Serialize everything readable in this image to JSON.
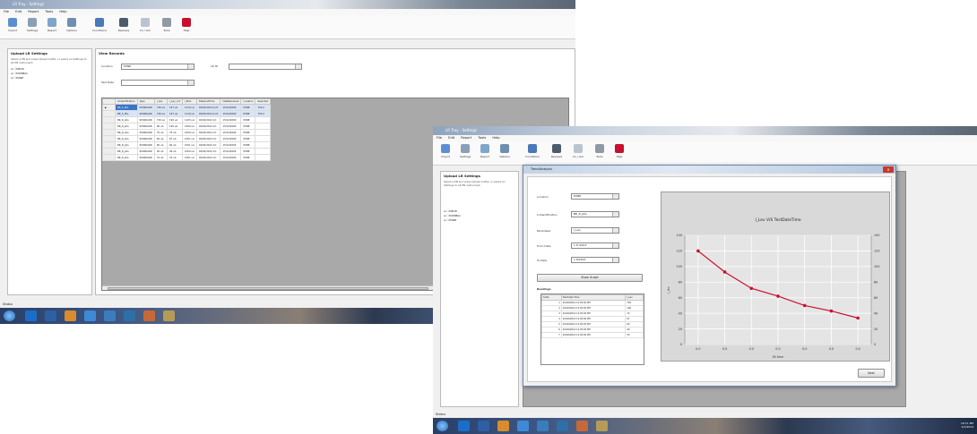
{
  "main_window": {
    "title": "LR Tray - Settings",
    "menu": [
      "File",
      "Edit",
      "Report",
      "Tools",
      "Help"
    ],
    "toolbar": [
      "Import",
      "Settings",
      "Report",
      "Options",
      "Conditions",
      "Reviews",
      "Co / Lim",
      "Tools",
      "Help"
    ],
    "left_panel": {
      "heading": "Upload LR Settings",
      "description": "Select a PN and press Upload button or select an Settings to LR PN instrument.",
      "tree": [
        "DELHI",
        "MUMBAI",
        "PUNE"
      ]
    },
    "view_records": {
      "heading": "View Records",
      "location_label": "Location",
      "location_value": "PUNE",
      "lrid_label": "LR ID",
      "lrid_value": "",
      "date_label": "Test Date",
      "date_value": ""
    },
    "grid": {
      "columns": [
        "LrIdentification",
        "Type",
        "I_Lev",
        "I_Lev_cnt",
        "I_Max",
        "DateAndTime",
        "DateReceived",
        "Location",
        "Reported"
      ],
      "rows": [
        [
          "BR_5_Phs",
          "STANDARD",
          "720 uA",
          "197 uA",
          "1110 uA",
          "02/02/2014 4:21",
          "15/12/2000",
          "PUNE",
          "720 A"
        ],
        [
          "BR_5_Phs",
          "STANDARD",
          "720 uA",
          "197 uA",
          "1110 uA",
          "02/02/2014 4:21",
          "15/12/2000",
          "PUNE",
          "720 A"
        ],
        [
          "BR_R_phs",
          "STANDARD",
          "720 uA",
          "190 uA",
          "1105 uA",
          "02/02/2014 12:",
          "15/12/2000",
          "PUNE",
          ""
        ],
        [
          "BR_R_phs",
          "STANDARD",
          "80 uA",
          "190 uA",
          "1050 uA",
          "02/02/2014 12:",
          "15/12/2000",
          "PUNE",
          ""
        ],
        [
          "BR_R_phs",
          "STANDARD",
          "70 uA",
          "70 uA",
          "1050 uA",
          "02/02/2014 12:",
          "15/12/2000",
          "PUNE",
          ""
        ],
        [
          "BR_R_phs",
          "STANDARD",
          "60 uA",
          "67 uA",
          "1051 uA",
          "02/02/2014 12:",
          "15/12/2000",
          "PUNE",
          ""
        ],
        [
          "BR_R_phs",
          "STANDARD",
          "60 uA",
          "60 uA",
          "1051 uA",
          "02/02/2014 12:",
          "15/12/2000",
          "PUNE",
          ""
        ],
        [
          "BR_R_phs",
          "STANDARD",
          "40 uA",
          "40 uA",
          "1050 uA",
          "02/02/2014 12:",
          "15/12/2000",
          "PUNE",
          ""
        ],
        [
          "BR_R_phs",
          "STANDARD",
          "31 uA",
          "33 uA",
          "1051 uA",
          "02/02/2014 12:",
          "15/12/2000",
          "PUNE",
          ""
        ]
      ]
    },
    "status": "Status"
  },
  "second_window": {
    "title": "LR Tray - Settings",
    "menu": [
      "File",
      "Edit",
      "Report",
      "Tools",
      "Help"
    ],
    "toolbar": [
      "Import",
      "Settings",
      "Report",
      "Options",
      "Conditions",
      "Reviews",
      "Co / Lim",
      "Tools",
      "Help"
    ],
    "left_panel": {
      "heading": "Upload LR Settings",
      "description": "Select a PN and press Upload button or select an Settings to LR PN instrument.",
      "tree": [
        "DELHI",
        "MUMBAI",
        "PUNE"
      ]
    },
    "status": "Status"
  },
  "dialog": {
    "title": "TrendAnalysis",
    "close_label": "✕",
    "fields": [
      {
        "label": "Location",
        "value": "PUNE"
      },
      {
        "label": "LrIdentification",
        "value": "BR_R_phs"
      },
      {
        "label": "Parameter",
        "value": "I_Lev"
      },
      {
        "label": "From Date",
        "value": "1  8 /2013"
      },
      {
        "label": "To Date",
        "value": "1  8/2014"
      }
    ],
    "show_button": "Show Graph",
    "readings_label": "Readings",
    "readings_columns": [
      "Sr.No.",
      "Test Date Time",
      "I_Lev"
    ],
    "readings_rows": [
      [
        "1",
        "02/02/2014 12:05:00 PM",
        "720"
      ],
      [
        "2",
        "02/02/2014 12:05:00 PM",
        "190"
      ],
      [
        "3",
        "02/02/2014 12:05:00 PM",
        "70"
      ],
      [
        "4",
        "02/02/2014 12:05:00 PM",
        "67"
      ],
      [
        "5",
        "02/02/2014 12:05:00 PM",
        "60"
      ],
      [
        "6",
        "02/02/2014 12:05:00 PM",
        "40"
      ],
      [
        "7",
        "02/02/2014 12:05:00 PM",
        "33"
      ]
    ],
    "next_button": "Next"
  },
  "chart_data": {
    "type": "line",
    "title": "I_Lev V/S TestDateTime",
    "xlabel": "Dt time",
    "ylabel": "I_lev",
    "x": [
      1,
      2,
      3,
      4,
      5,
      6,
      7
    ],
    "x_ticks": [
      "0.0",
      "0.0",
      "0.0",
      "0.0",
      "0.0",
      "0.0",
      "0.0"
    ],
    "y_ticks": [
      "0",
      "20",
      "40",
      "60",
      "80",
      "100",
      "120",
      "140"
    ],
    "ylim": [
      0,
      140
    ],
    "series": [
      {
        "values": [
          120,
          93,
          72,
          62,
          50,
          43,
          34
        ]
      }
    ],
    "colors": {
      "line": "#c8102e",
      "plot_bg": "#e5e5e5",
      "grid": "#ffffff"
    },
    "grid": true
  },
  "taskbar": {
    "clock_time": "10:11 PM",
    "clock_date": "1/1/2014"
  }
}
